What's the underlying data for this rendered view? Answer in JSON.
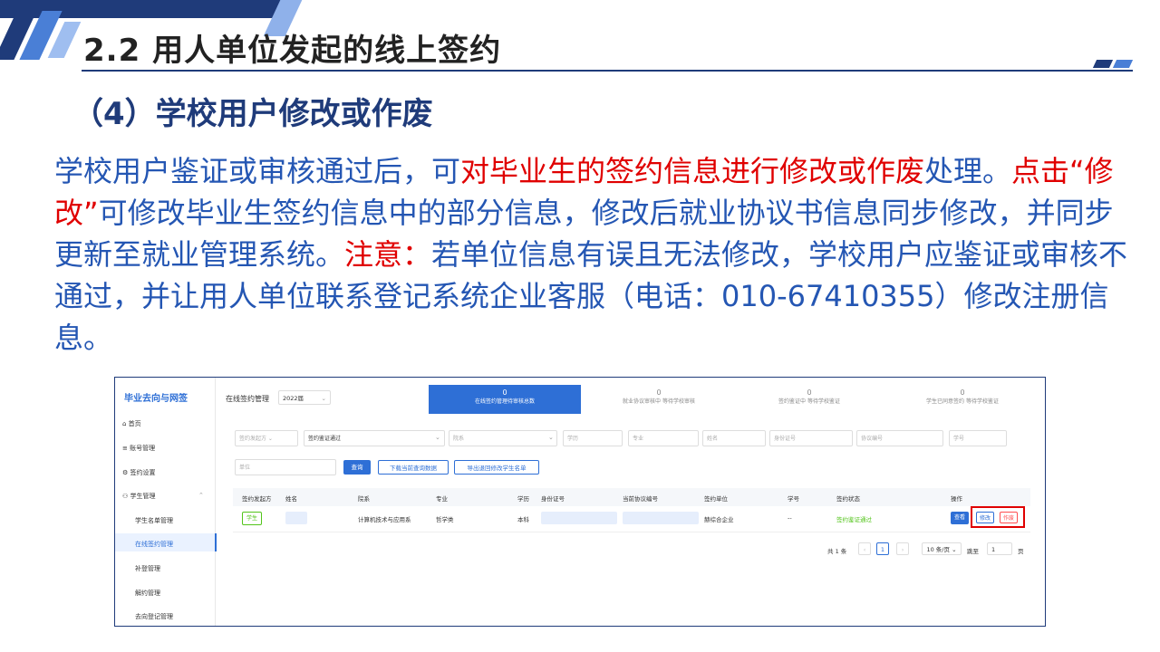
{
  "slide": {
    "title": "2.2 用人单位发起的线上签约",
    "subtitle": "（4）学校用户修改或作废",
    "paragraph": [
      {
        "text": "学校用户鉴证或审核通过后，可",
        "red": false
      },
      {
        "text": "对毕业生的签约信息进行修改或作废",
        "red": true
      },
      {
        "text": "处理。",
        "red": false
      },
      {
        "text": "点击“修改”",
        "red": true
      },
      {
        "text": "可修改毕业生签约信息中的部分信息，修改后就业协议书信息同步修改，并同步更新至就业管理系统。",
        "red": false
      },
      {
        "text": "注意：",
        "red": true
      },
      {
        "text": "若单位信息有误且无法修改，学校用户应鉴证或审核不通过，并让用人单位联系登记系统企业客服（电话：010-67410355）修改注册信息。",
        "red": false
      }
    ],
    "colors": {
      "title_bar": "#1f3b7a",
      "text_blue": "#2456b3",
      "highlight_red": "#e00000"
    }
  },
  "app": {
    "brand": "毕业去向与网签",
    "sidebar": [
      {
        "label": "首页",
        "icon": "home-icon"
      },
      {
        "label": "账号管理",
        "icon": "menu-icon"
      },
      {
        "label": "签约设置",
        "icon": "gear-icon"
      },
      {
        "label": "学生管理",
        "icon": "user-group-icon"
      },
      {
        "label": "学生名单管理",
        "icon": ""
      },
      {
        "label": "在线签约管理",
        "icon": ""
      },
      {
        "label": "补登管理",
        "icon": ""
      },
      {
        "label": "解约管理",
        "icon": ""
      },
      {
        "label": "去向登记管理",
        "icon": ""
      }
    ],
    "page_title": "在线签约管理",
    "year": "2022届",
    "stats": [
      {
        "count": "0",
        "label": "在线签约管理待审核总数"
      },
      {
        "count": "0",
        "label": "就业协议审核中 等待学校审核"
      },
      {
        "count": "0",
        "label": "签约鉴证中 等待学校鉴证"
      },
      {
        "count": "0",
        "label": "学生已同意签约 等待学校鉴证"
      }
    ],
    "filters": {
      "initiator": "签约发起方",
      "status": "签约鉴证通过",
      "department": "院系",
      "education": "学历",
      "major": "专业",
      "name": "姓名",
      "id_number": "身份证号",
      "agreement_no": "协议编号",
      "student_no": "学号",
      "unit": "单位"
    },
    "buttons": {
      "query": "查询",
      "download": "下载当前查询数据",
      "export": "导出退回修改学生名单"
    },
    "table": {
      "headers": [
        "签约发起方",
        "姓名",
        "院系",
        "专业",
        "学历",
        "身份证号",
        "当前协议编号",
        "签约单位",
        "学号",
        "签约状态",
        "操作"
      ],
      "row": {
        "initiator": "学生",
        "department": "计算机技术与应用系",
        "major": "哲学类",
        "education": "本科",
        "unit": "赫综合企业",
        "student_no": "--",
        "status": "签约鉴证通过",
        "actions": {
          "view": "查看",
          "edit": "修改",
          "void": "作废"
        }
      }
    },
    "pager": {
      "total": "共 1 条",
      "current": "1",
      "page_size": "10 条/页",
      "goto": "跳至",
      "goto_value": "1",
      "unit": "页"
    }
  }
}
